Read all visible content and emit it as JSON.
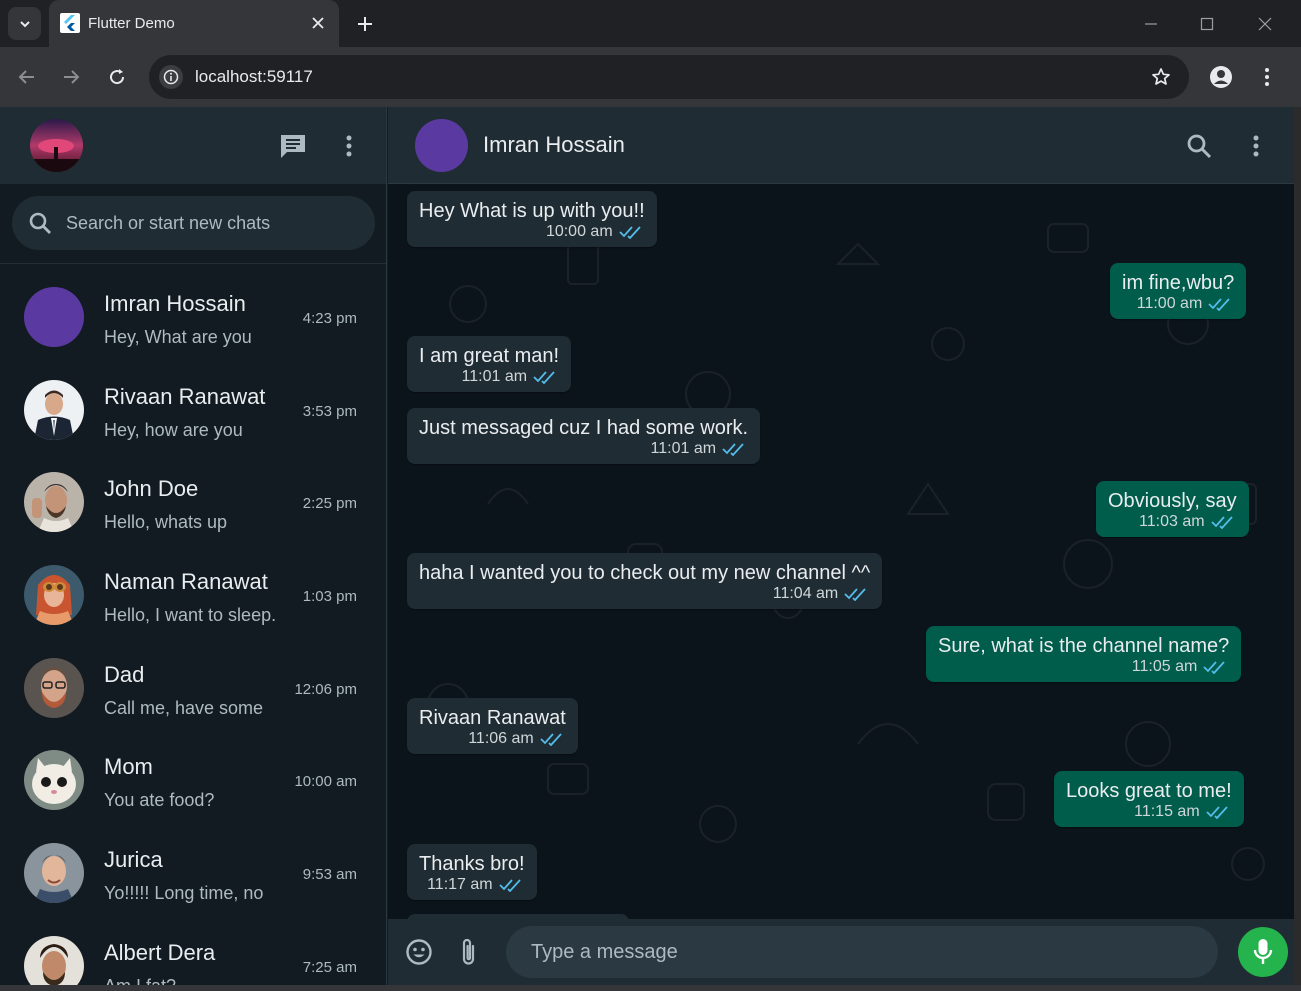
{
  "browser": {
    "tab_title": "Flutter Demo",
    "url": "localhost:59117"
  },
  "sidebar": {
    "search_placeholder": "Search or start new chats",
    "chats": [
      {
        "name": "Imran Hossain",
        "preview": "Hey, What are you",
        "time": "4:23 pm",
        "avatar": "purple-circle"
      },
      {
        "name": "Rivaan Ranawat",
        "preview": "Hey, how are you",
        "time": "3:53 pm",
        "avatar": "man-in-suit-photo"
      },
      {
        "name": "John Doe",
        "preview": "Hello, whats up",
        "time": "2:25 pm",
        "avatar": "bearded-man-photo"
      },
      {
        "name": "Naman Ranawat",
        "preview": "Hello, I want to sleep.",
        "time": "1:03 pm",
        "avatar": "woman-with-goggles-photo"
      },
      {
        "name": "Dad",
        "preview": "Call me, have some",
        "time": "12:06 pm",
        "avatar": "man-with-glasses-photo"
      },
      {
        "name": "Mom",
        "preview": "You ate food?",
        "time": "10:00 am",
        "avatar": "cat-photo"
      },
      {
        "name": "Jurica",
        "preview": "Yo!!!!! Long time, no",
        "time": "9:53 am",
        "avatar": "smiling-man-photo"
      },
      {
        "name": "Albert Dera",
        "preview": "Am I fat?",
        "time": "7:25 am",
        "avatar": "curly-hair-man-photo"
      }
    ]
  },
  "conversation": {
    "contact_name": "Imran Hossain",
    "composer_placeholder": "Type a message",
    "messages": [
      {
        "text": "Hey What is up with you!!",
        "time": "10:00 am",
        "direction": "in"
      },
      {
        "text": "im fine,wbu?",
        "time": "11:00 am",
        "direction": "out"
      },
      {
        "text": "I am great man!",
        "time": "11:01 am",
        "direction": "in"
      },
      {
        "text": "Just messaged cuz I had some work.",
        "time": "11:01 am",
        "direction": "in"
      },
      {
        "text": "Obviously, say",
        "time": "11:03 am",
        "direction": "out"
      },
      {
        "text": "haha I wanted you to check out my new channel ^^",
        "time": "11:04 am",
        "direction": "in"
      },
      {
        "text": "Sure, what is the channel name?",
        "time": "11:05 am",
        "direction": "out"
      },
      {
        "text": "Rivaan Ranawat",
        "time": "11:06 am",
        "direction": "in"
      },
      {
        "text": "Looks great to me!",
        "time": "11:15 am",
        "direction": "out"
      },
      {
        "text": "Thanks bro!",
        "time": "11:17 am",
        "direction": "in"
      }
    ]
  },
  "colors": {
    "header_bg": "#202c33",
    "chat_bg": "#0b141a",
    "incoming_bubble": "#202c33",
    "outgoing_bubble": "#005c4b",
    "read_tick": "#53bdeb",
    "mic_button": "#25b34d"
  }
}
